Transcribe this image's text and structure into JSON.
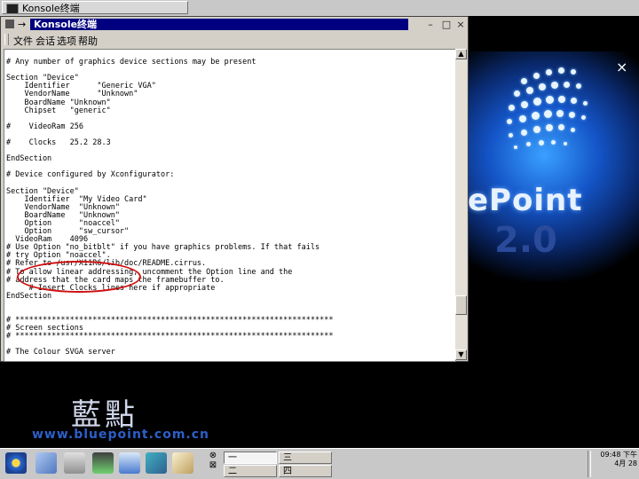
{
  "top_task": {
    "label": "Konsole终端"
  },
  "window": {
    "title": "Konsole终端",
    "menu": [
      "文件",
      "会话",
      "选项",
      "帮助"
    ],
    "sticky_glyph": "→",
    "buttons": {
      "minimize": "–",
      "maximize": "□",
      "close": "×"
    }
  },
  "terminal": {
    "lines": [
      "",
      "# Any number of graphics device sections may be present",
      "",
      "Section \"Device\"",
      "    Identifier      \"Generic VGA\"",
      "    VendorName      \"Unknown\"",
      "    BoardName \"Unknown\"",
      "    Chipset   \"generic\"",
      "",
      "#    VideoRam 256",
      "",
      "#    Clocks   25.2 28.3",
      "",
      "EndSection",
      "",
      "# Device configured by Xconfigurator:",
      "",
      "Section \"Device\"",
      "    Identifier  \"My Video Card\"",
      "    VendorName  \"Unknown\"",
      "    BoardName   \"Unknown\"",
      "    Option      \"noaccel\"",
      "    Option      \"sw_cursor\"",
      "  VideoRam    4096",
      "# Use Option \"no_bitblt\" if you have graphics problems. If that fails",
      "# try Option \"noaccel\".",
      "# Refer to /usr/X11R6/lib/doc/README.cirrus.",
      "# To allow linear addressing, uncomment the Option line and the",
      "# address that the card maps the framebuffer to.",
      "     # Insert Clocks lines here if appropriate",
      "EndSection",
      "",
      "",
      "# **********************************************************************",
      "# Screen sections",
      "# **********************************************************************",
      "",
      "# The Colour SVGA server"
    ]
  },
  "desktop": {
    "brand_word": "ePoint",
    "brand_version": "2.0",
    "close_glyph": "×"
  },
  "logo": {
    "chinese": "藍點",
    "url": "www.bluepoint.com.cn"
  },
  "taskbar": {
    "pager_glyphs": [
      "⊗",
      "⊠"
    ],
    "desktops": [
      "一",
      "三",
      "二",
      "四"
    ],
    "clock_time": "09:48 下午",
    "clock_date": "4月 28"
  }
}
